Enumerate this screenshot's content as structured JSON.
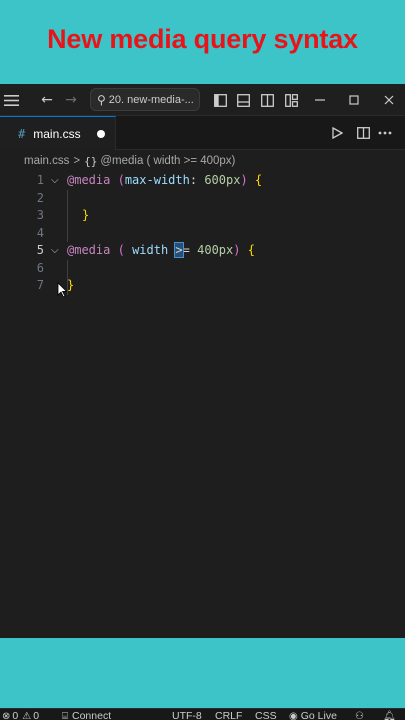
{
  "banner": {
    "title": "New media query syntax"
  },
  "titlebar": {
    "command_center": "20. new-media-...",
    "icons": [
      "menu-icon",
      "arrow-left-icon",
      "arrow-right-icon",
      "search-icon",
      "toggle-primary-sidebar-icon",
      "toggle-panel-icon",
      "toggle-secondary-sidebar-icon",
      "customize-layout-icon",
      "minimize-icon",
      "maximize-icon",
      "close-icon"
    ]
  },
  "tab": {
    "label": "main.css",
    "file_icon": "#"
  },
  "breadcrumb": {
    "file": "main.css",
    "separator": ">",
    "symbol_icon": "{}",
    "symbol": "@media ( width >= 400px)"
  },
  "code": {
    "lines": [
      {
        "n": "1",
        "at": "@media",
        "open_paren": "(",
        "prop": "max-width",
        "colon": ":",
        "value": "600px",
        "close_paren": ")",
        "brace": "{"
      },
      {
        "n": "2"
      },
      {
        "n": "3",
        "brace": "}"
      },
      {
        "n": "4"
      },
      {
        "n": "5",
        "at": "@media",
        "open_paren": "(",
        "prop": "width",
        "op_sel": ">",
        "op_rest": "=",
        "value": "400px",
        "close_paren": ")",
        "brace": "{"
      },
      {
        "n": "6"
      },
      {
        "n": "7",
        "brace": "}"
      }
    ]
  },
  "statusbar": {
    "errors": "0",
    "warnings": "0",
    "connect": "Connect",
    "encoding": "UTF-8",
    "eol": "CRLF",
    "language": "CSS",
    "golive": "Go Live"
  },
  "colors": {
    "banner_bg": "#3cc4c8",
    "banner_text": "#e8141a",
    "editor_bg": "#1e1e1e",
    "keyword": "#c586c0",
    "property": "#9cdcfe",
    "number": "#b5cea8",
    "brace": "#ffd700"
  }
}
